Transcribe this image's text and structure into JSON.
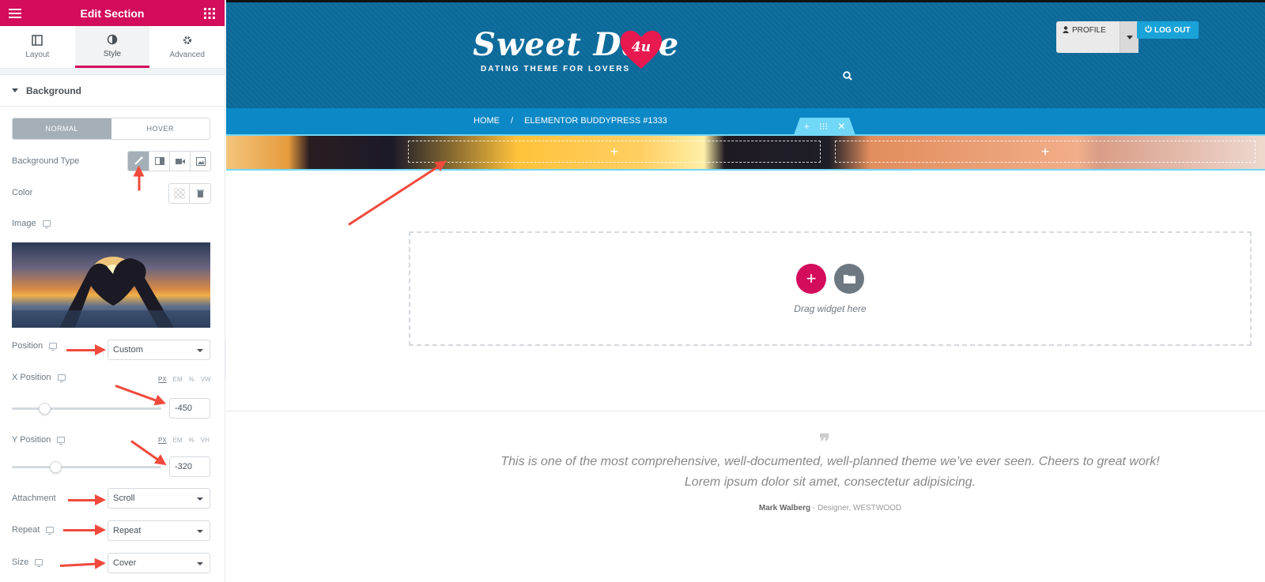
{
  "panel": {
    "title": "Edit Section",
    "tabs": [
      {
        "label": "Layout"
      },
      {
        "label": "Style"
      },
      {
        "label": "Advanced"
      }
    ],
    "section_title": "Background",
    "state_toggle": {
      "normal": "NORMAL",
      "hover": "HOVER",
      "active": "normal"
    },
    "controls": {
      "background_type_label": "Background Type",
      "color_label": "Color",
      "image_label": "Image",
      "position_label": "Position",
      "position_value": "Custom",
      "x_position_label": "X Position",
      "x_units": [
        "PX",
        "EM",
        "%",
        "VW"
      ],
      "x_value": "-450",
      "y_position_label": "Y Position",
      "y_units": [
        "PX",
        "EM",
        "%",
        "VH"
      ],
      "y_value": "-320",
      "attachment_label": "Attachment",
      "attachment_value": "Scroll",
      "repeat_label": "Repeat",
      "repeat_value": "Repeat",
      "size_label": "Size",
      "size_value": "Cover"
    },
    "accent_color": "#d30c5c"
  },
  "site": {
    "logo_text": "Sweet Date",
    "logo_badge": "4u",
    "logo_tagline": "DATING THEME FOR LOVERS",
    "profile_label": "PROFILE",
    "logout_label": "LOG OUT",
    "breadcrumb": {
      "home": "HOME",
      "separator": "/",
      "current": "ELEMENTOR BUDDYPRESS #1333"
    },
    "section_handle_icons": [
      "plus-icon",
      "drag-handle-icon",
      "close-icon"
    ],
    "drop_text": "Drag widget here",
    "quote_text": "This is one of the most comprehensive, well-documented, well-planned theme we’ve ever seen. Cheers to great work! Lorem ipsum dolor sit amet, consectetur adipisicing.",
    "author_name": "Mark Walberg",
    "author_role": " - Designer, WESTWOOD"
  }
}
